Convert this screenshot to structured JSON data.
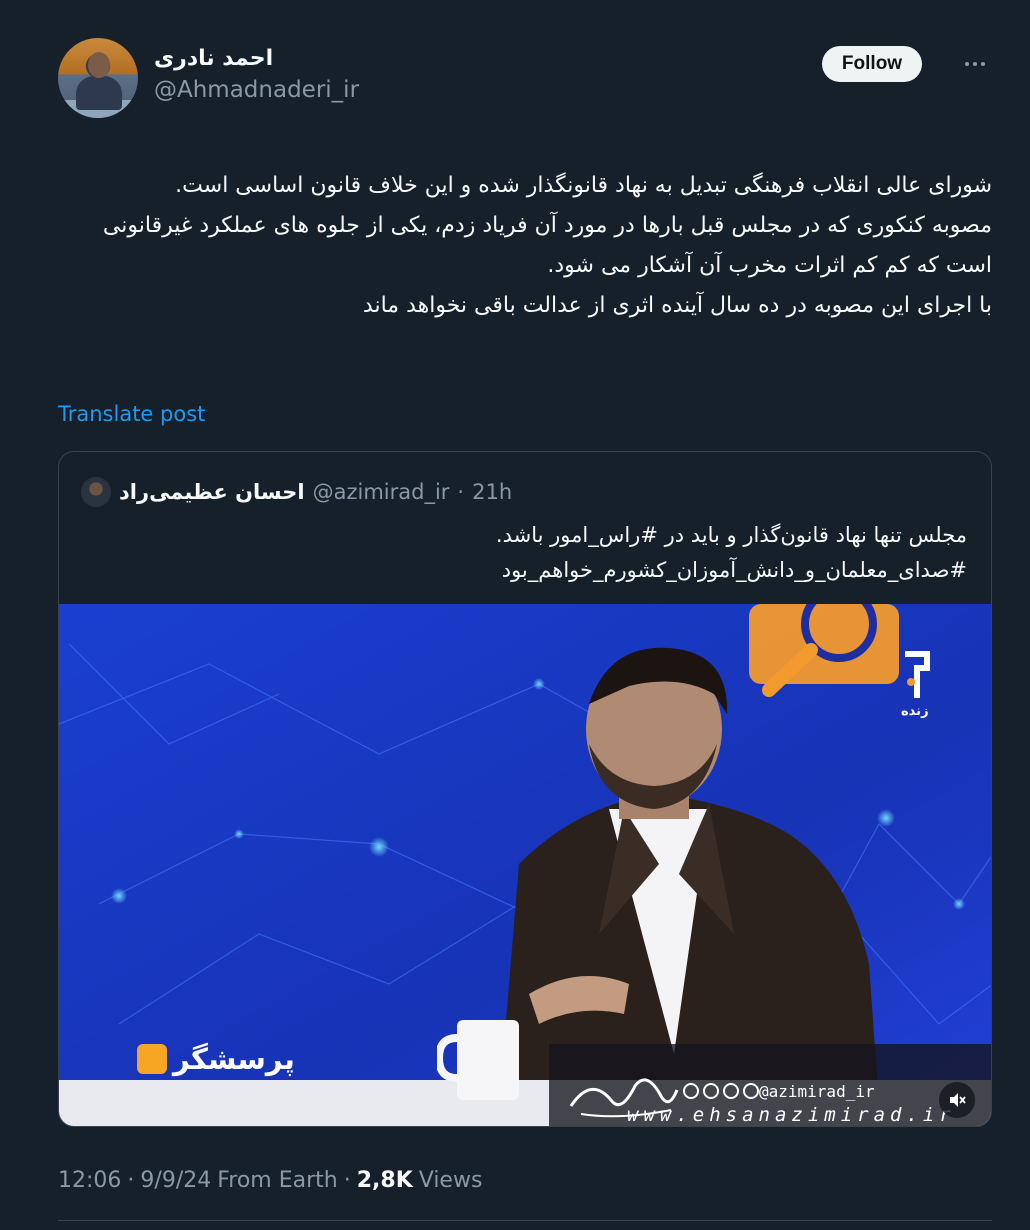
{
  "author": {
    "display_name": "احمد نادری",
    "handle": "@Ahmadnaderi_ir"
  },
  "follow_label": "Follow",
  "tweet_lines": [
    "شورای عالی انقلاب فرهنگی تبدیل به نهاد قانونگذار شده و این خلاف قانون اساسی است.",
    "مصوبه کنکوری که در مجلس قبل بارها در مورد آن فریاد زدم، یکی از جلوه های عملکرد غیرقانونی است که کم کم اثرات مخرب آن آشکار می شود.",
    "با اجرای این مصوبه در ده سال آینده اثری از عدالت باقی نخواهد ماند"
  ],
  "translate_label": "Translate post",
  "quote": {
    "display_name": "احسان عظیمی‌راد",
    "handle": "@azimirad_ir",
    "separator": "·",
    "time": "21h",
    "lines": [
      "مجلس تنها نهاد قانون‌گذار و باید در #راس_امور باشد.",
      "#صدای_معلمان_و_دانش_آموزان_کشورم_خواهم_بود"
    ],
    "video": {
      "channel_logo_text": "پرسشگر",
      "live_text": "زنده",
      "watermark_handle": "@azimirad_ir",
      "watermark_site": "www.ehsanazimirad.ir",
      "watermark_signature": "احسان عظیمی راد",
      "muted": true
    }
  },
  "meta": {
    "time": "12:06",
    "sep1": "·",
    "date": "9/9/24",
    "source": "From Earth",
    "sep2": "·",
    "views_count": "2,8K",
    "views_label": "Views"
  },
  "colors": {
    "background": "#15202b",
    "link": "#1d9bf0",
    "secondary_text": "#8b98a5",
    "border": "#38444d"
  }
}
